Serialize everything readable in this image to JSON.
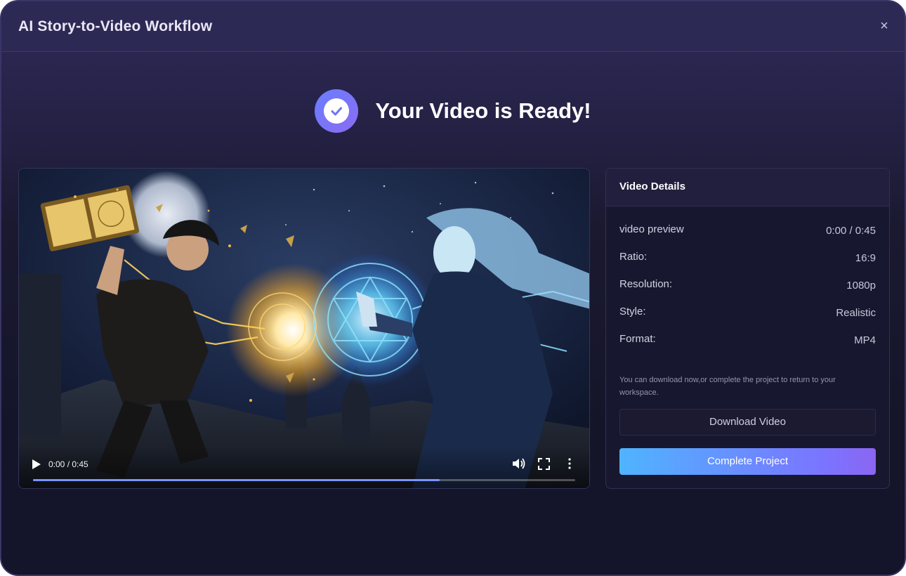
{
  "window": {
    "title": "AI Story-to-Video Workflow",
    "close_glyph": "×"
  },
  "status": {
    "headline": "Your Video is Ready!",
    "icon": "check-circle-icon"
  },
  "player": {
    "current_time": "0:00 / 0:45",
    "progress": 0.75,
    "controls": [
      "play-icon",
      "volume-icon",
      "fullscreen-icon",
      "more-vertical-icon"
    ]
  },
  "details": {
    "heading": "Video Details",
    "rows": [
      {
        "key": "video preview",
        "value": "0:00 / 0:45"
      },
      {
        "key": "Ratio:",
        "value": "16:9"
      },
      {
        "key": "Resolution:",
        "value": "1080p"
      },
      {
        "key": "Style:",
        "value": "Realistic"
      },
      {
        "key": "Format:",
        "value": "MP4"
      }
    ],
    "note": "You can download now,or complete the project to return to your workspace.",
    "download_label": "Download Video",
    "complete_label": "Complete Project"
  },
  "colors": {
    "accent_start": "#4fb4ff",
    "accent_end": "#8a66f2",
    "progress": "#7b93ff"
  }
}
